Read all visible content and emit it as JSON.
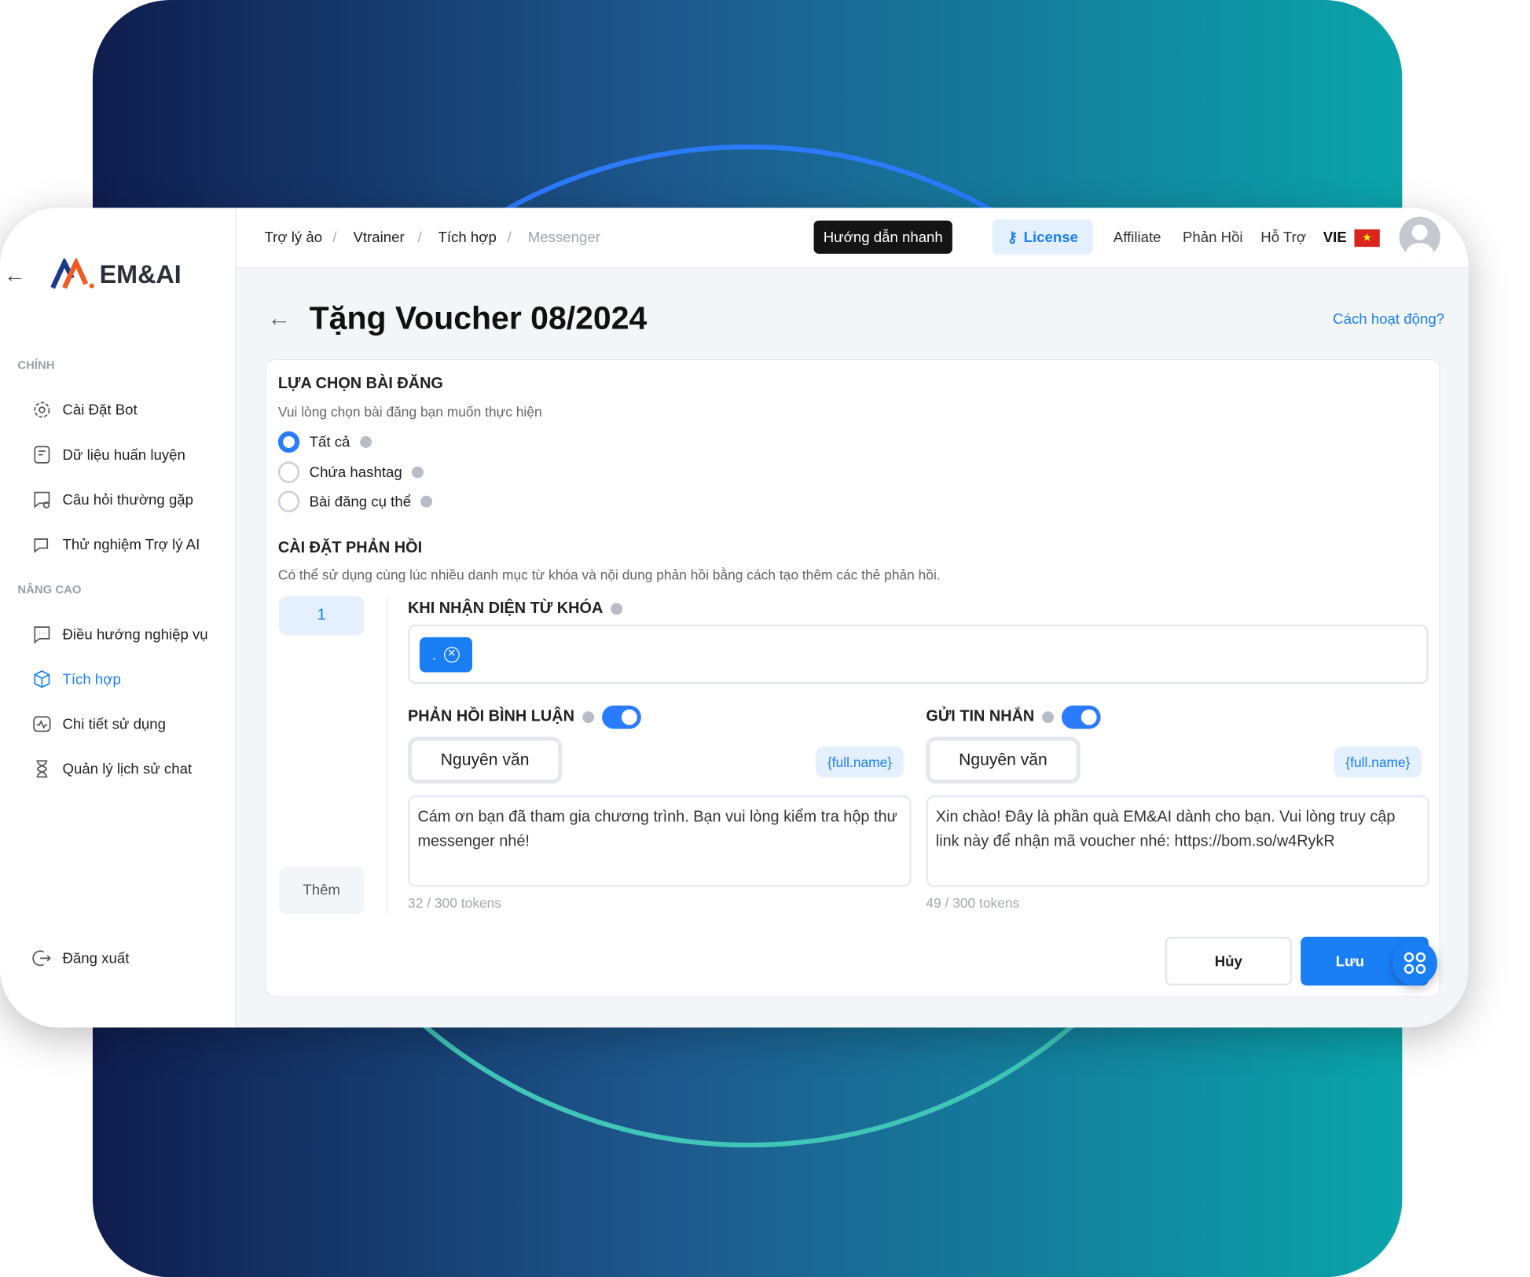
{
  "brand": {
    "logo_text": "EM&AI"
  },
  "breadcrumb": [
    "Trợ lý ảo",
    "Vtrainer",
    "Tích hợp",
    "Messenger"
  ],
  "topbar": {
    "quick_guide": "Hướng dẫn nhanh",
    "license": "License",
    "affiliate": "Affiliate",
    "feedback": "Phản Hồi",
    "support": "Hỗ Trợ",
    "language": "VIE"
  },
  "sidebar": {
    "section_main": "CHÍNH",
    "main_items": [
      {
        "label": "Cài Đặt Bot",
        "icon": "gear-icon"
      },
      {
        "label": "Dữ liệu huấn luyện",
        "icon": "document-icon"
      },
      {
        "label": "Câu hỏi thường gặp",
        "icon": "chat-search-icon"
      },
      {
        "label": "Thử nghiệm Trợ lý AI",
        "icon": "chat-icon"
      }
    ],
    "section_advanced": "NÂNG CAO",
    "advanced_items": [
      {
        "label": "Điều hướng nghiệp vụ",
        "icon": "chat-dots-icon"
      },
      {
        "label": "Tích hợp",
        "icon": "cube-icon",
        "active": true
      },
      {
        "label": "Chi tiết sử dụng",
        "icon": "activity-icon"
      },
      {
        "label": "Quản lý lịch sử chat",
        "icon": "hourglass-icon"
      }
    ],
    "logout": "Đăng xuất"
  },
  "page": {
    "title": "Tặng Voucher 08/2024",
    "how_it_works": "Cách hoạt động?"
  },
  "post_select": {
    "heading": "LỰA CHỌN BÀI ĐĂNG",
    "desc": "Vui lòng chọn bài đăng bạn muốn thực hiện",
    "options": [
      "Tất cả",
      "Chứa hashtag",
      "Bài đăng cụ thể"
    ],
    "selected": "Tất cả"
  },
  "reply": {
    "heading": "CÀI ĐẶT PHẢN HỒI",
    "desc": "Có thể sử dụng cùng lúc nhiều danh mục từ khóa và nội dung phản hồi bằng cách tạo thêm các thẻ phản hồi.",
    "card_number": "1",
    "add_label": "Thêm",
    "keyword_label": "KHI NHẬN DIỆN TỪ KHÓA",
    "keyword_tag": ".",
    "comment": {
      "label": "PHẢN HỒI BÌNH LUẬN",
      "enabled": true,
      "name_button": "Nguyên văn",
      "chip": "{full.name}",
      "text": "Cám ơn bạn đã tham gia chương trình. Bạn vui lòng kiểm tra hộp thư messenger nhé!",
      "tokens": "32 / 300 tokens"
    },
    "message": {
      "label": "GỬI TIN NHẮN",
      "enabled": true,
      "name_button": "Nguyên văn",
      "chip": "{full.name}",
      "text": "Xin chào! Đây là phần quà EM&AI dành cho bạn. Vui lòng truy cập link này để nhận mã voucher nhé: https://bom.so/w4RykR",
      "tokens": "49 / 300 tokens"
    }
  },
  "actions": {
    "cancel": "Hủy",
    "save": "Lưu"
  },
  "colors": {
    "accent": "#1a7ff5",
    "dark_button": "#141414"
  }
}
